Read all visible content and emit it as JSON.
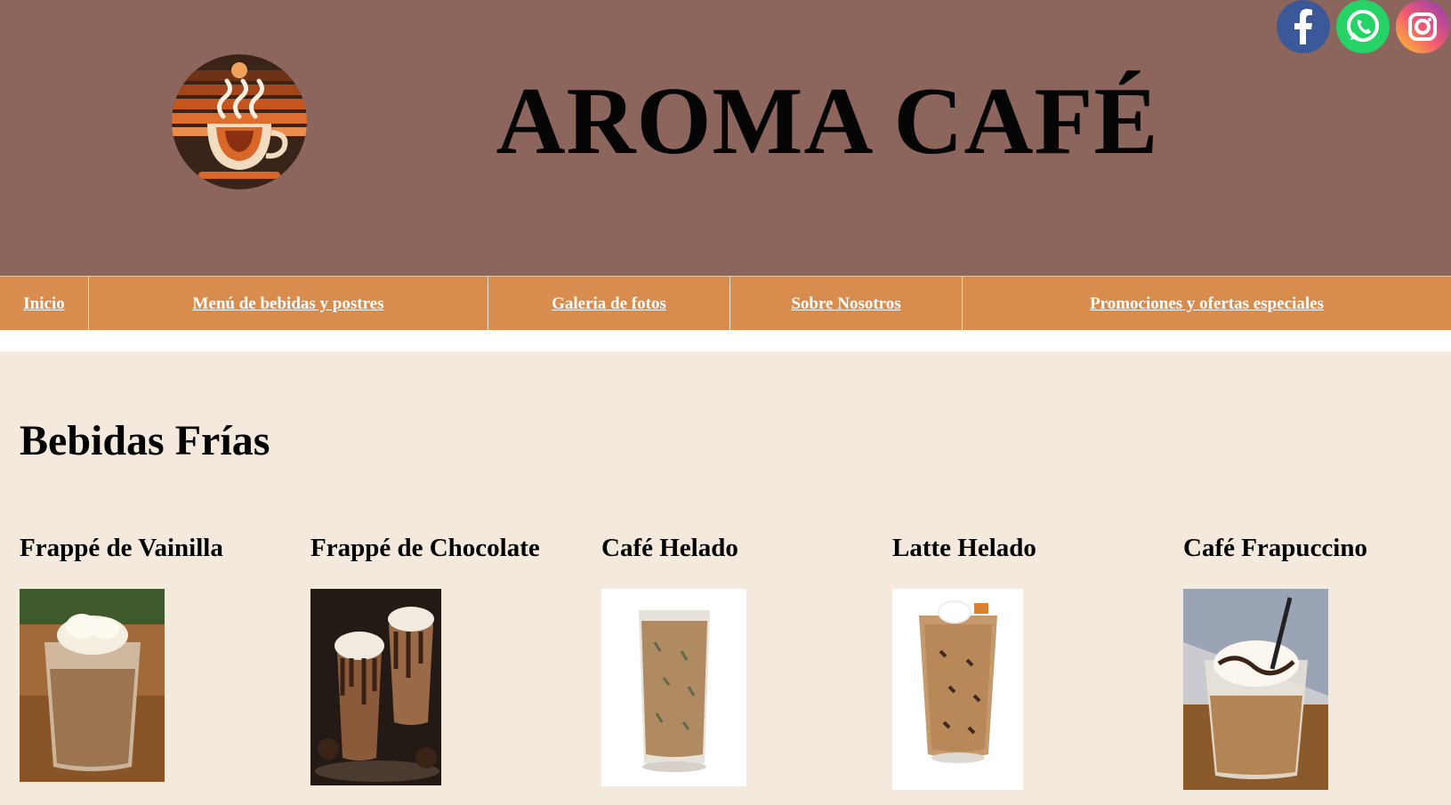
{
  "header": {
    "title": "AROMA CAFÉ",
    "background": "#8c655d",
    "logo": "coffee-cup-logo-icon",
    "social": [
      {
        "name": "facebook-icon",
        "color": "#3b5998"
      },
      {
        "name": "whatsapp-icon",
        "color": "#25d366"
      },
      {
        "name": "instagram-icon",
        "color": "#d6249f"
      }
    ]
  },
  "nav": {
    "background": "#d88d4f",
    "items": [
      {
        "label": "Inicio"
      },
      {
        "label": "Menú de bebidas y postres"
      },
      {
        "label": "Galeria de fotos"
      },
      {
        "label": "Sobre Nosotros"
      },
      {
        "label": "Promociones y ofertas especiales"
      }
    ]
  },
  "main": {
    "background": "#f3e9dc",
    "section_title": "Bebidas Frías",
    "products": [
      {
        "name": "Frappé de Vainilla",
        "image": "vanilla-frappe-photo"
      },
      {
        "name": "Frappé de Chocolate",
        "image": "chocolate-frappe-photo"
      },
      {
        "name": "Café Helado",
        "image": "iced-coffee-photo"
      },
      {
        "name": "Latte Helado",
        "image": "iced-latte-photo"
      },
      {
        "name": "Café Frapuccino",
        "image": "frappuccino-photo"
      }
    ]
  }
}
